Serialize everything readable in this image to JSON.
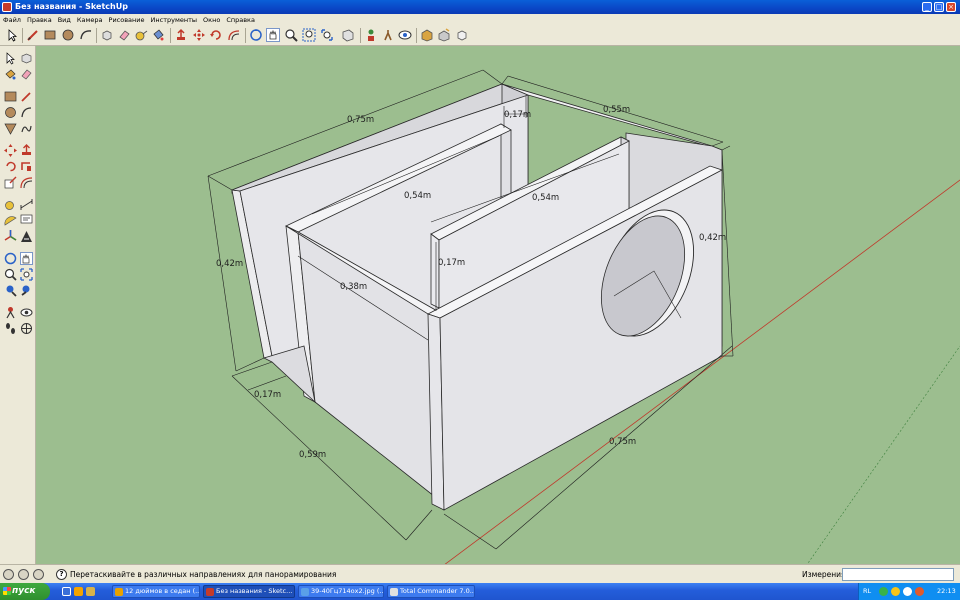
{
  "window": {
    "title": "Без названия - SketchUp"
  },
  "menu": [
    "Файл",
    "Правка",
    "Вид",
    "Камера",
    "Рисование",
    "Инструменты",
    "Окно",
    "Справка"
  ],
  "dimensions": {
    "top_width": "0,75m",
    "top_depth": "0,55m",
    "top_gap": "0,17m",
    "inner_1": "0,54m",
    "inner_2": "0,54m",
    "right_height": "0,42m",
    "left_height": "0,42m",
    "inner_gap": "0,17m",
    "inner_depth": "0,38m",
    "bottom_gap": "0,17m",
    "bottom_depth": "0,59m",
    "bottom_width": "0,75m"
  },
  "status": {
    "hint": "Перетаскивайте в различных направлениях для панорамирования",
    "measure_label": "Измерения",
    "measure_value": ""
  },
  "taskbar": {
    "start": "пуск",
    "tasks": [
      {
        "label": "12 дюймов в седан (...",
        "active": false
      },
      {
        "label": "Без названия - Sketc...",
        "active": true
      },
      {
        "label": "39-40Гц714ох2.jpg (...",
        "active": false
      },
      {
        "label": "Total Commander 7.0...",
        "active": false
      }
    ],
    "lang": "RL",
    "clock": "22:13"
  },
  "colors": {
    "canvas": "#9cbe8f",
    "box_face": "#e4e4e8",
    "box_edge": "#2a2a2a",
    "dim_line": "#1e1e1e",
    "axis_red": "#c0392b"
  }
}
